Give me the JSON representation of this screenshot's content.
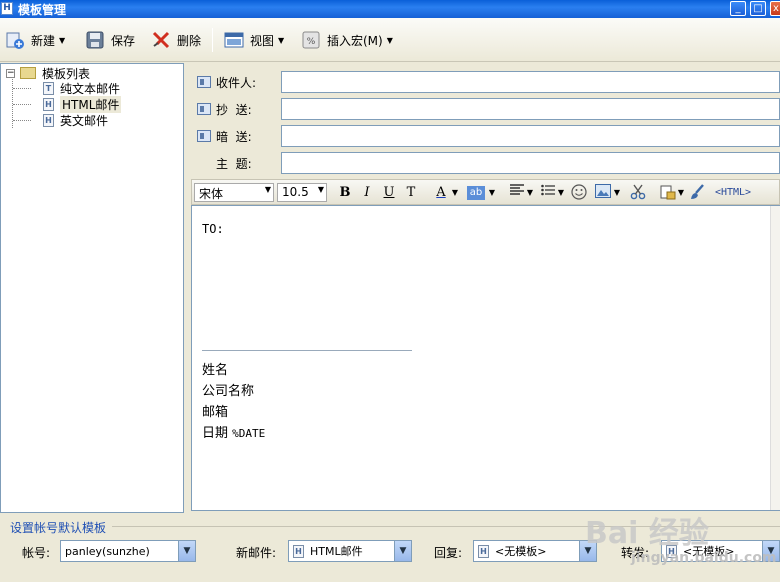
{
  "window": {
    "title": "模板管理",
    "min": "_",
    "max": "□",
    "close": "x"
  },
  "toolbar": {
    "new_label": "新建",
    "save_label": "保存",
    "delete_label": "删除",
    "view_label": "视图",
    "insert_macro_label": "插入宏(M)"
  },
  "tree": {
    "root": "模板列表",
    "items": [
      {
        "label": "纯文本邮件",
        "icon_letter": "T",
        "icon": "text-doc-icon"
      },
      {
        "label": "HTML邮件",
        "icon_letter": "H",
        "icon": "html-doc-icon",
        "selected": true
      },
      {
        "label": "英文邮件",
        "icon_letter": "H",
        "icon": "html-doc-icon"
      }
    ]
  },
  "fields": {
    "to_label": "收件人:",
    "cc_label": "抄  送:",
    "bcc_label": "暗  送:",
    "subject_label": "主  题:",
    "to_value": "",
    "cc_value": "",
    "bcc_value": "",
    "subject_value": ""
  },
  "editor_toolbar": {
    "font": "宋体",
    "size": "10.5",
    "bold": "B",
    "italic": "I",
    "underline": "U",
    "strike": "T",
    "font_color": "A",
    "highlight": "ab",
    "html_label": "<HTML>"
  },
  "editor": {
    "to_line": "TO:",
    "sig_name": "姓名",
    "sig_company": "公司名称",
    "sig_email": "邮箱",
    "sig_date_label": "日期",
    "sig_date_macro": "%DATE"
  },
  "bottom": {
    "group_title": "设置帐号默认模板",
    "account_label": "帐号:",
    "account_value": "panley(sunzhe)",
    "new_mail_label": "新邮件:",
    "new_mail_value": "HTML邮件",
    "reply_label": "回复:",
    "reply_value": "<无模板>",
    "forward_label": "转发:",
    "forward_value": "<无模板>"
  },
  "watermark": {
    "main": "Bai 经验",
    "sub": "jingyan.baidu.com"
  },
  "colors": {
    "title_bar": "#1560d6",
    "accent": "#1f4fb4",
    "border": "#7f9db9"
  }
}
